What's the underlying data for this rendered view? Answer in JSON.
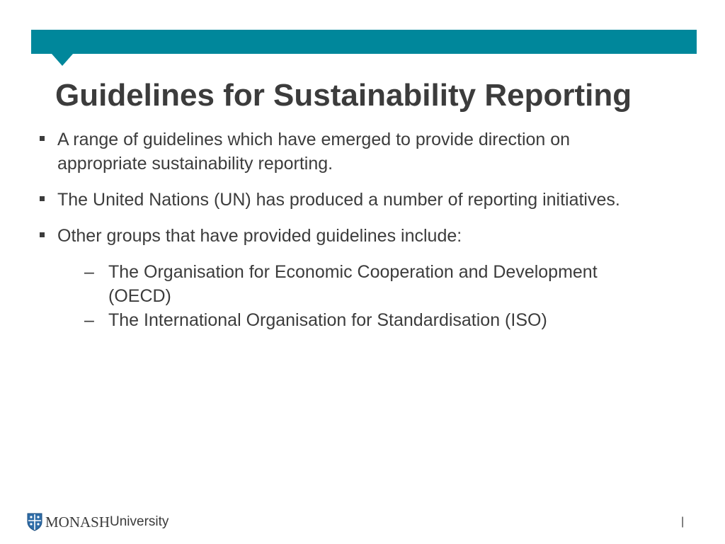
{
  "slide": {
    "title": "Guidelines for Sustainability Reporting",
    "accent_color": "#00879b",
    "bullets": [
      {
        "text": "A range of guidelines which have emerged to provide direction on appropriate sustainability reporting."
      },
      {
        "text": "The United Nations (UN) has produced a number of reporting initiatives."
      },
      {
        "text": "Other groups that have provided guidelines include:",
        "sub_items": [
          "The Organisation for Economic Cooperation and Development (OECD)",
          "The International Organisation for Standardisation (ISO)"
        ]
      }
    ],
    "bullet_marker": "▪",
    "sub_bullet_marker": "–"
  },
  "footer": {
    "logo_icon": "monash-crest-icon",
    "logo_word_1": "MONASH",
    "logo_word_2": "University",
    "page_separator": "|"
  }
}
